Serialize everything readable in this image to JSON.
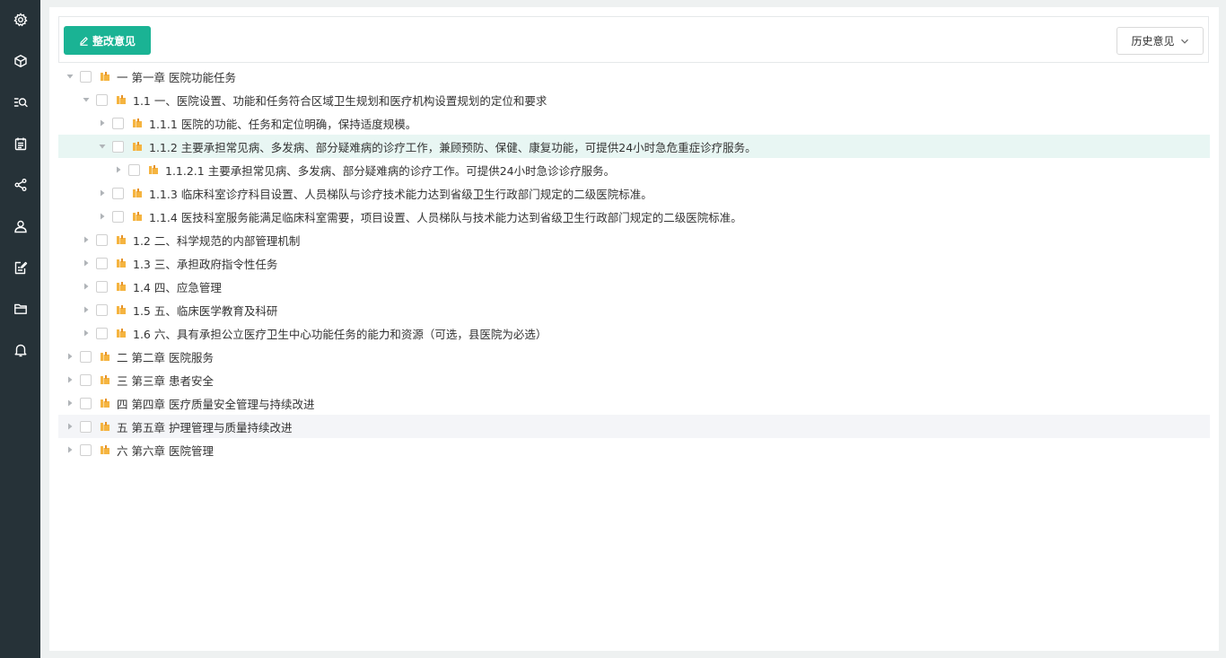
{
  "sidebar": {
    "items": [
      {
        "icon": "settings-icon"
      },
      {
        "icon": "cube-icon"
      },
      {
        "icon": "search-list-icon"
      },
      {
        "icon": "calendar-icon"
      },
      {
        "icon": "share-icon"
      },
      {
        "icon": "user-icon"
      },
      {
        "icon": "edit-document-icon"
      },
      {
        "icon": "folder-icon"
      },
      {
        "icon": "bell-icon"
      }
    ]
  },
  "toolbar": {
    "rectify_label": "整改意见",
    "history_label": "历史意见"
  },
  "colors": {
    "sidebar_bg": "#263238",
    "accent": "#1ab394",
    "folder": "#f5b440",
    "selected_row": "#e8f6f3"
  },
  "tree": {
    "rows": [
      {
        "level": 0,
        "state": "expanded",
        "label": "一 第一章 医院功能任务"
      },
      {
        "level": 1,
        "state": "expanded",
        "label": "1.1 一、医院设置、功能和任务符合区域卫生规划和医疗机构设置规划的定位和要求"
      },
      {
        "level": 2,
        "state": "collapsed",
        "label": "1.1.1 医院的功能、任务和定位明确，保持适度规模。"
      },
      {
        "level": 2,
        "state": "expanded",
        "label": "1.1.2 主要承担常见病、多发病、部分疑难病的诊疗工作，兼顾预防、保健、康复功能，可提供24小时急危重症诊疗服务。",
        "selected": true
      },
      {
        "level": 3,
        "state": "collapsed",
        "label": "1.1.2.1 主要承担常见病、多发病、部分疑难病的诊疗工作。可提供24小时急诊诊疗服务。"
      },
      {
        "level": 2,
        "state": "collapsed",
        "label": "1.1.3 临床科室诊疗科目设置、人员梯队与诊疗技术能力达到省级卫生行政部门规定的二级医院标准。"
      },
      {
        "level": 2,
        "state": "collapsed",
        "label": "1.1.4 医技科室服务能满足临床科室需要，项目设置、人员梯队与技术能力达到省级卫生行政部门规定的二级医院标准。"
      },
      {
        "level": 1,
        "state": "collapsed",
        "label": "1.2 二、科学规范的内部管理机制"
      },
      {
        "level": 1,
        "state": "collapsed",
        "label": "1.3 三、承担政府指令性任务"
      },
      {
        "level": 1,
        "state": "collapsed",
        "label": "1.4 四、应急管理"
      },
      {
        "level": 1,
        "state": "collapsed",
        "label": "1.5 五、临床医学教育及科研"
      },
      {
        "level": 1,
        "state": "collapsed",
        "label": "1.6 六、具有承担公立医疗卫生中心功能任务的能力和资源（可选，县医院为必选）"
      },
      {
        "level": 0,
        "state": "collapsed",
        "label": "二 第二章 医院服务"
      },
      {
        "level": 0,
        "state": "collapsed",
        "label": "三 第三章 患者安全"
      },
      {
        "level": 0,
        "state": "collapsed",
        "label": "四 第四章 医疗质量安全管理与持续改进"
      },
      {
        "level": 0,
        "state": "collapsed",
        "label": "五 第五章 护理管理与质量持续改进",
        "hovered": true
      },
      {
        "level": 0,
        "state": "collapsed",
        "label": "六 第六章 医院管理"
      }
    ]
  }
}
